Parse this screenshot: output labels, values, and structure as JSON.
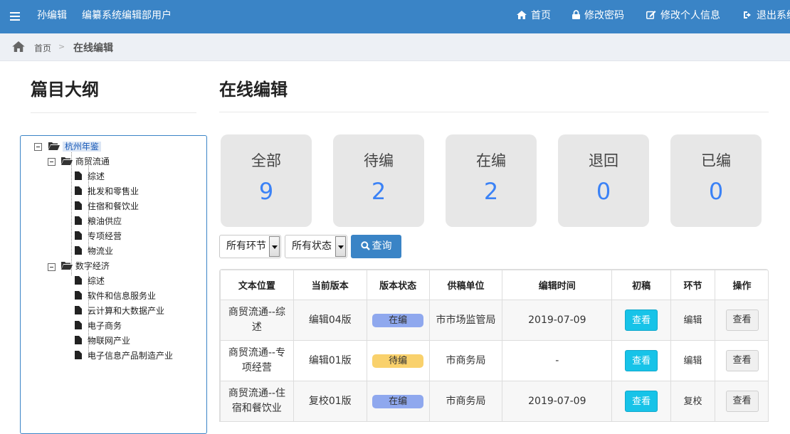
{
  "topbar": {
    "user_name": "孙编辑",
    "user_role": "编纂系统编辑部用户",
    "links": [
      {
        "label": "首页",
        "icon": "home-icon"
      },
      {
        "label": "修改密码",
        "icon": "lock-icon"
      },
      {
        "label": "修改个人信息",
        "icon": "edit-icon"
      },
      {
        "label": "退出系统",
        "icon": "logout-icon"
      }
    ]
  },
  "breadcrumb": {
    "home": "首页",
    "separator": ">",
    "current": "在线编辑"
  },
  "outline": {
    "title": "篇目大纲",
    "tree": [
      {
        "label": "杭州年鉴",
        "icon": "folder-open-icon",
        "selected": true
      },
      {
        "label": "商贸流通",
        "icon": "folder-open-icon"
      },
      {
        "label": "综述",
        "icon": "file-icon"
      },
      {
        "label": "批发和零售业",
        "icon": "file-icon"
      },
      {
        "label": "住宿和餐饮业",
        "icon": "file-icon"
      },
      {
        "label": "粮油供应",
        "icon": "file-icon"
      },
      {
        "label": "专项经营",
        "icon": "file-icon"
      },
      {
        "label": "物流业",
        "icon": "file-icon"
      },
      {
        "label": "数字经济",
        "icon": "folder-open-icon"
      },
      {
        "label": "综述",
        "icon": "file-icon"
      },
      {
        "label": "软件和信息服务业",
        "icon": "file-icon"
      },
      {
        "label": "云计算和大数据产业",
        "icon": "file-icon"
      },
      {
        "label": "电子商务",
        "icon": "file-icon"
      },
      {
        "label": "物联网产业",
        "icon": "file-icon"
      },
      {
        "label": "电子信息产品制造产业",
        "icon": "file-icon"
      }
    ]
  },
  "main": {
    "title": "在线编辑",
    "stats": [
      {
        "label": "全部",
        "value": "9"
      },
      {
        "label": "待编",
        "value": "2"
      },
      {
        "label": "在编",
        "value": "2"
      },
      {
        "label": "退回",
        "value": "0"
      },
      {
        "label": "已编",
        "value": "0"
      }
    ],
    "filters": {
      "stage": "所有环节",
      "status": "所有状态",
      "query_label": "查询"
    },
    "table": {
      "headers": [
        "文本位置",
        "当前版本",
        "版本状态",
        "供稿单位",
        "编辑时间",
        "初稿",
        "环节",
        "操作"
      ],
      "rows": [
        {
          "location": "商贸流通--综述",
          "version": "编辑04版",
          "status": "在编",
          "status_color": "#8fa8ee",
          "unit": "市市场监管局",
          "time": "2019-07-09",
          "draft": "查看",
          "stage": "编辑",
          "action": "查看"
        },
        {
          "location": "商贸流通--专项经营",
          "version": "编辑01版",
          "status": "待编",
          "status_color": "#f9d16c",
          "unit": "市商务局",
          "time": "-",
          "draft": "查看",
          "stage": "编辑",
          "action": "查看"
        },
        {
          "location": "商贸流通--住宿和餐饮业",
          "version": "复校01版",
          "status": "在编",
          "status_color": "#8fa8ee",
          "unit": "市商务局",
          "time": "2019-07-09",
          "draft": "查看",
          "stage": "复校",
          "action": "查看"
        }
      ]
    }
  }
}
